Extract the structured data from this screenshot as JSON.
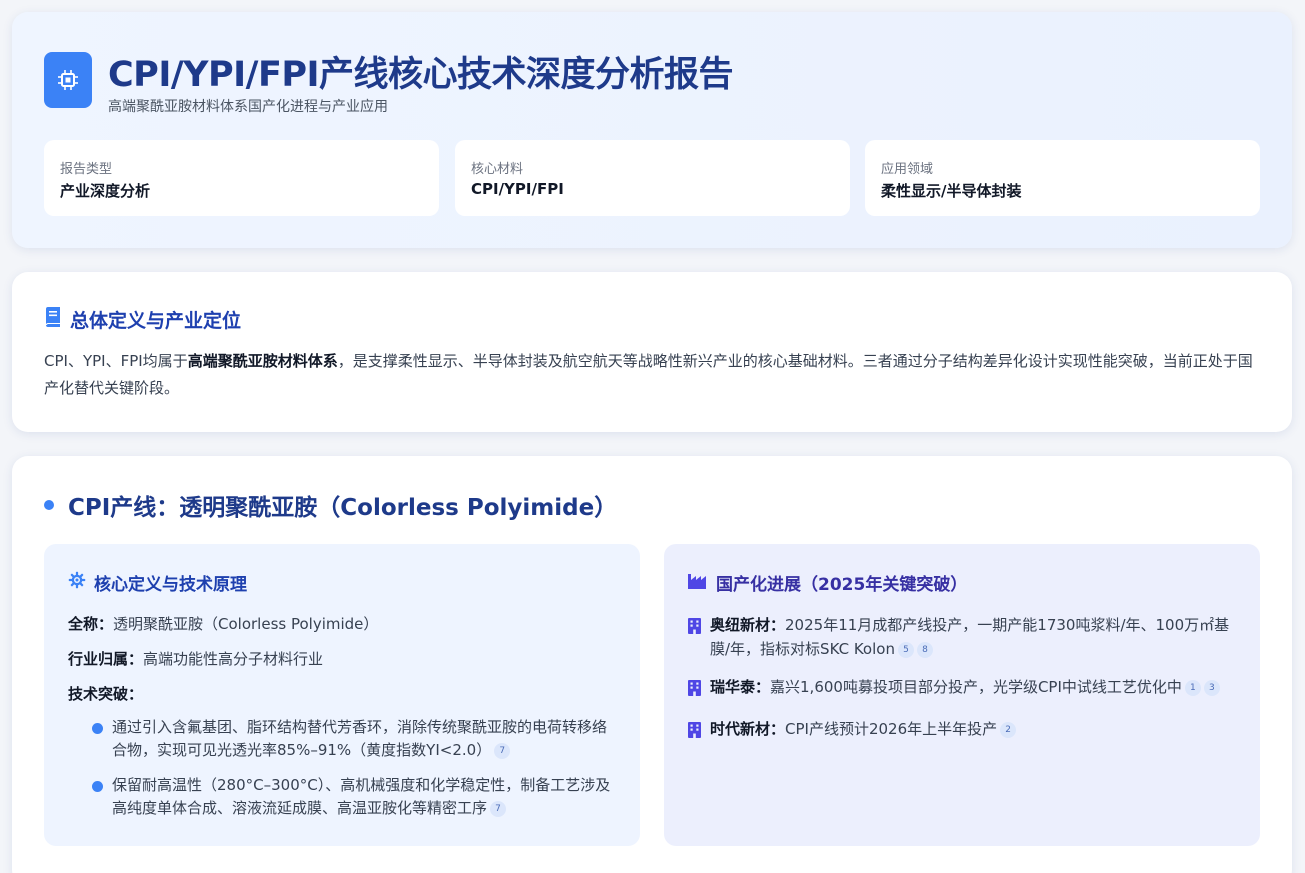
{
  "header": {
    "title": "CPI/YPI/FPI产线核心技术深度分析报告",
    "subtitle": "高端聚酰亚胺材料体系国产化进程与产业应用",
    "logo_icon": "chip-icon",
    "meta": [
      {
        "label": "报告类型",
        "value": "产业深度分析"
      },
      {
        "label": "核心材料",
        "value": "CPI/YPI/FPI"
      },
      {
        "label": "应用领域",
        "value": "柔性显示/半导体封装"
      }
    ]
  },
  "overview": {
    "icon": "book-icon",
    "heading": "总体定义与产业定位",
    "text_before": "CPI、YPI、FPI均属于",
    "text_bold": "高端聚酰亚胺材料体系",
    "text_after": "，是支撑柔性显示、半导体封装及航空航天等战略性新兴产业的核心基础材料。三者通过分子结构差异化设计实现性能突破，当前正处于国产化替代关键阶段。"
  },
  "cpi": {
    "title": "CPI产线：透明聚酰亚胺（Colorless Polyimide）",
    "definition": {
      "icon": "gear-icon",
      "heading": "核心定义与技术原理",
      "full_name_label": "全称：",
      "full_name_value": "透明聚酰亚胺（Colorless Polyimide）",
      "industry_label": "行业归属：",
      "industry_value": "高端功能性高分子材料行业",
      "breakthrough_label": "技术突破：",
      "bullets": [
        {
          "text": "通过引入含氟基团、脂环结构替代芳香环，消除传统聚酰亚胺的电荷转移络合物，实现可见光透光率85%–91%（黄度指数YI<2.0）",
          "cites": [
            "7"
          ]
        },
        {
          "text": "保留耐高温性（280°C–300°C）、高机械强度和化学稳定性，制备工艺涉及高纯度单体合成、溶液流延成膜、高温亚胺化等精密工序",
          "cites": [
            "7"
          ]
        }
      ]
    },
    "progress": {
      "icon": "factory-icon",
      "heading": "国产化进展（2025年关键突破）",
      "items": [
        {
          "company": "奥纽新材：",
          "text": "2025年11月成都产线投产，一期产能1730吨浆料/年、100万㎡基膜/年，指标对标SKC Kolon",
          "cites": [
            "5",
            "8"
          ]
        },
        {
          "company": "瑞华泰：",
          "text": "嘉兴1,600吨募投项目部分投产，光学级CPI中试线工艺优化中",
          "cites": [
            "1",
            "3"
          ]
        },
        {
          "company": "时代新材：",
          "text": "CPI产线预计2026年上半年投产",
          "cites": [
            "2"
          ]
        }
      ]
    }
  },
  "colors": {
    "accent": "#3b82f6",
    "heading": "#1e3a8a",
    "indigo": "#3730a3"
  }
}
